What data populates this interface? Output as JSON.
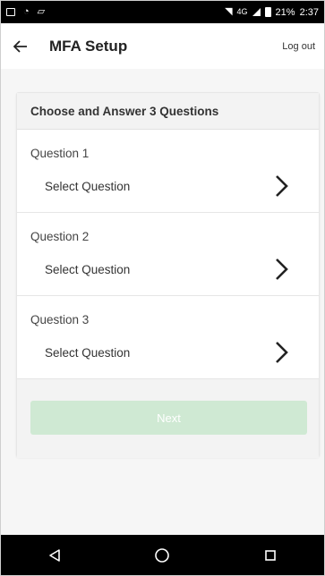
{
  "status_bar": {
    "network_label": "4G",
    "battery_percent": "21%",
    "time": "2:37"
  },
  "app_bar": {
    "title": "MFA Setup",
    "logout_label": "Log out"
  },
  "card": {
    "header": "Choose and Answer 3 Questions",
    "questions": [
      {
        "label": "Question 1",
        "select_text": "Select Question"
      },
      {
        "label": "Question 2",
        "select_text": "Select Question"
      },
      {
        "label": "Question 3",
        "select_text": "Select Question"
      }
    ],
    "next_label": "Next"
  },
  "colors": {
    "next_button_disabled": "#cfe9d3",
    "status_bar": "#000000",
    "header_bg": "#f3f3f3"
  },
  "icons": {
    "back": "arrow-left-icon",
    "chevron": "chevron-right-icon",
    "nav": [
      "back-triangle-icon",
      "home-circle-icon",
      "recents-square-icon"
    ]
  }
}
